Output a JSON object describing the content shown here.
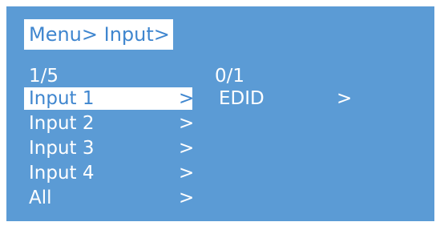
{
  "menu": {
    "breadcrumb": "Menu> Input>",
    "left": {
      "page_indicator": "1/5",
      "items": [
        {
          "label": "Input 1",
          "arrow": ">"
        },
        {
          "label": "Input 2",
          "arrow": ">"
        },
        {
          "label": "Input 3",
          "arrow": ">"
        },
        {
          "label": "Input 4",
          "arrow": ">"
        },
        {
          "label": "All",
          "arrow": ">"
        }
      ],
      "selected_index": 0
    },
    "right": {
      "page_indicator": "0/1",
      "items": [
        {
          "label": "EDID",
          "arrow": ">"
        }
      ]
    }
  },
  "colors": {
    "background": "#5b9bd5",
    "highlight": "#ffffff",
    "highlight_text": "#3f86cf",
    "text": "#ffffff"
  }
}
